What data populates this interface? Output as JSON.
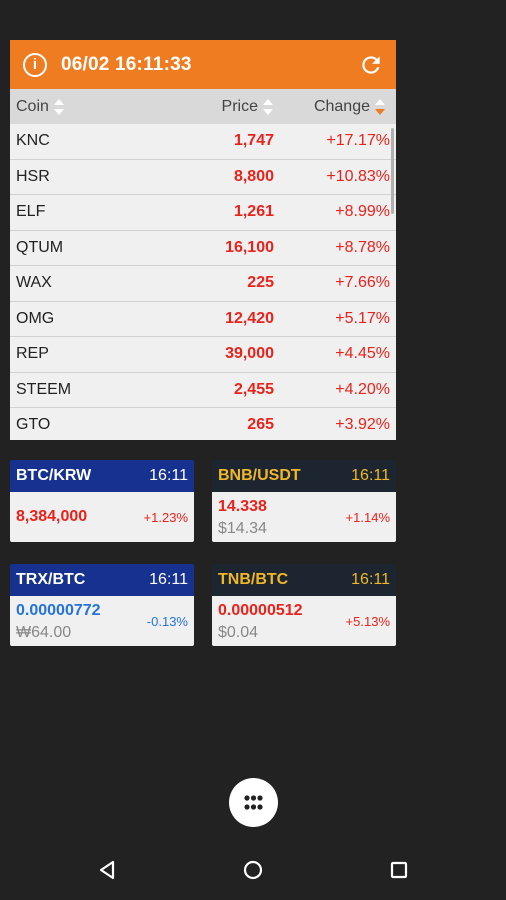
{
  "widget": {
    "time": "06/02 16:11:33",
    "columns": {
      "coin": "Coin",
      "price": "Price",
      "change": "Change"
    },
    "rows": [
      {
        "coin": "KNC",
        "price": "1,747",
        "change": "+17.17%"
      },
      {
        "coin": "HSR",
        "price": "8,800",
        "change": "+10.83%"
      },
      {
        "coin": "ELF",
        "price": "1,261",
        "change": "+8.99%"
      },
      {
        "coin": "QTUM",
        "price": "16,100",
        "change": "+8.78%"
      },
      {
        "coin": "WAX",
        "price": "225",
        "change": "+7.66%"
      },
      {
        "coin": "OMG",
        "price": "12,420",
        "change": "+5.17%"
      },
      {
        "coin": "REP",
        "price": "39,000",
        "change": "+4.45%"
      },
      {
        "coin": "STEEM",
        "price": "2,455",
        "change": "+4.20%"
      },
      {
        "coin": "GTO",
        "price": "265",
        "change": "+3.92%"
      }
    ],
    "accent_color": "#f07c22",
    "up_color": "#e8231c"
  },
  "cards": [
    {
      "pair": "BTC/KRW",
      "time": "16:11",
      "price": "8,384,000",
      "sub": "",
      "change": "+1.23%"
    },
    {
      "pair": "BNB/USDT",
      "time": "16:11",
      "price": "14.338",
      "sub": "$14.34",
      "change": "+1.14%"
    },
    {
      "pair": "TRX/BTC",
      "time": "16:11",
      "price": "0.00000772",
      "sub": "₩64.00",
      "change": "-0.13%"
    },
    {
      "pair": "TNB/BTC",
      "time": "16:11",
      "price": "0.00000512",
      "sub": "$0.04",
      "change": "+5.13%"
    }
  ],
  "icons": {
    "info": "info-icon",
    "refresh": "refresh-icon",
    "sort": "sort-icon",
    "apps": "apps-grid-icon",
    "back": "back-icon",
    "home": "home-icon",
    "recents": "recents-icon"
  }
}
